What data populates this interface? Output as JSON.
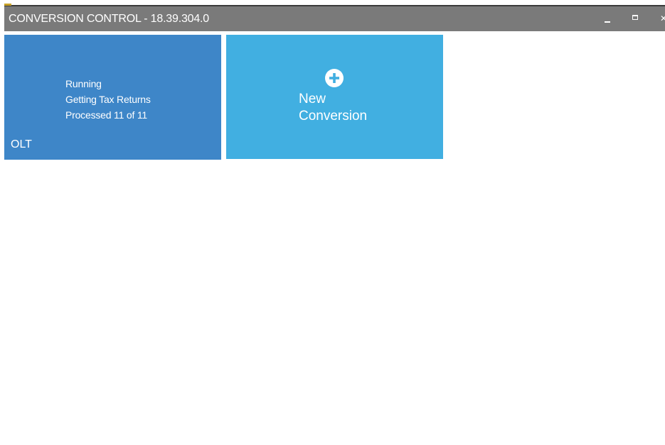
{
  "window": {
    "title": "CONVERSION CONTROL - 18.39.304.0",
    "controls": {
      "minimize_icon": "minimize-icon",
      "maximize_icon": "maximize-icon",
      "close_icon": "close-icon",
      "close_glyph": "✕"
    }
  },
  "tiles": [
    {
      "name": "OLT",
      "status": [
        "Running",
        "Getting Tax Returns",
        "Processed 11 of 11"
      ],
      "color": "#3e86c8"
    },
    {
      "label_line1": "New",
      "label_line2": "Conversion",
      "icon": "plus-circle-icon",
      "color": "#41afe1"
    }
  ],
  "colors": {
    "titlebar": "#7a7a7a",
    "text": "#ffffff",
    "background": "#ffffff"
  }
}
